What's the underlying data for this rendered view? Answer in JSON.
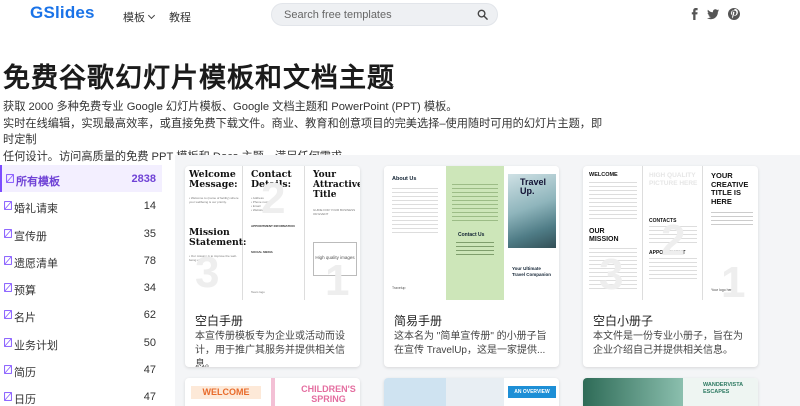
{
  "header": {
    "logo_g": "G",
    "logo_rest": "Slides",
    "nav_templates": "模板",
    "nav_tutorial": "教程",
    "search_placeholder": "Search free templates"
  },
  "hero": {
    "title": "免费谷歌幻灯片模板和文档主题",
    "desc_line1": "获取 2000 多种免费专业 Google 幻灯片模板、Google 文档主题和 PowerPoint (PPT) 模板。",
    "desc_line2": "实时在线编辑，实现最高效率，或直接免费下载文件。商业、教育和创意项目的完美选择–使用随时可用的幻灯片主题，即时定制",
    "desc_line3": "任何设计。访问高质量的免费 PPT 模板和 Docs 主题，满足任何需求。"
  },
  "sidebar": {
    "items": [
      {
        "label": "所有模板",
        "count": "2838"
      },
      {
        "label": "婚礼请柬",
        "count": "14"
      },
      {
        "label": "宣传册",
        "count": "35"
      },
      {
        "label": "遗愿清单",
        "count": "78"
      },
      {
        "label": "预算",
        "count": "34"
      },
      {
        "label": "名片",
        "count": "62"
      },
      {
        "label": "业务计划",
        "count": "50"
      },
      {
        "label": "简历",
        "count": "47"
      },
      {
        "label": "日历",
        "count": "47"
      }
    ]
  },
  "cards": [
    {
      "title": "空白手册",
      "desc": "本宣传册模板专为企业或活动而设计，用于推广其服务并提供相关信息。",
      "thumb": {
        "welcome": "Welcome Message:",
        "mission": "Mission Statement:",
        "contact": "Contact Details:",
        "attractive": "Your Attractive Title",
        "hq": "High quality images",
        "appointment": "APPOINTMENT INFORMATION",
        "social": "SOCIAL MEDIA",
        "guide": "GUIDE FOR YOUR BUSINESS OR EVENT",
        "teamlogo": "Team logo"
      }
    },
    {
      "title": "简易手册",
      "desc": "这本名为 \"简单宣传册\" 的小册子旨在宣传 TravelUp，这是一家提供...",
      "thumb": {
        "about": "About Us",
        "contact": "Contact Us",
        "travel": "Travel Up.",
        "companion": "Your Ultimate Travel Companion",
        "footer": "Travelup"
      }
    },
    {
      "title": "空白小册子",
      "desc": "本文件是一份专业小册子，旨在为企业介绍自己并提供相关信息。",
      "thumb": {
        "welcome": "WELCOME",
        "mission": "OUR MISSION",
        "hq": "HIGH QUALITY PICTURE HERE",
        "contacts": "CONTACTS",
        "appointment": "APPOINTMENT",
        "creative": "YOUR CREATIVE TITLE IS HERE",
        "logo": "Your logo here"
      }
    }
  ],
  "cards_row2": [
    {
      "banner": "WELCOME",
      "children": "CHILDREN'S SPRING"
    },
    {
      "overview": "AN OVERVIEW"
    },
    {
      "escape": "WANDERVISTA ESCAPES"
    }
  ],
  "colors": {
    "brand": "#1a73e8",
    "accent": "#7c4dff",
    "grid_bg": "#f4f5f7"
  }
}
